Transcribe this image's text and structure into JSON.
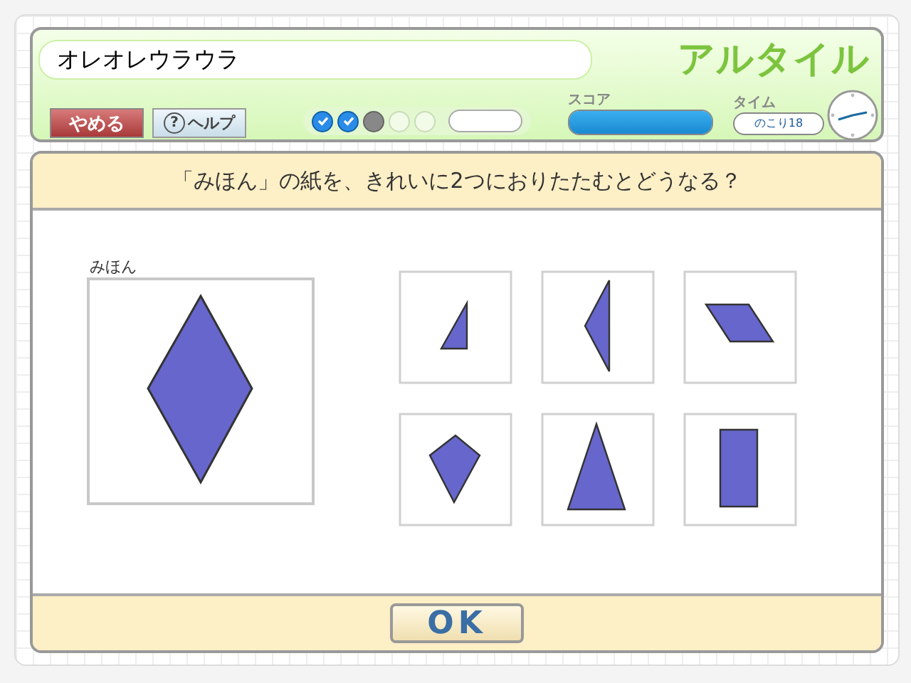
{
  "header": {
    "player_name": "オレオレウラウラ",
    "logo": "アルタイル",
    "quit_button": "やめる",
    "help_button": "ヘルプ",
    "help_icon": "?",
    "progress": [
      {
        "kind": "done"
      },
      {
        "kind": "done"
      },
      {
        "kind": "current"
      },
      {
        "kind": "pending"
      },
      {
        "kind": "pending"
      }
    ],
    "score_label": "スコア",
    "score": {
      "level": 1
    },
    "time_label": "タイム",
    "time_remaining": "のこり18"
  },
  "question": "「みほん」の紙を、きれいに2つにおりたたむとどうなる？",
  "sample": {
    "label": "みほん",
    "kind": "rhombus"
  },
  "options": [
    {
      "kind": "small-triangle"
    },
    {
      "kind": "tall-triangle"
    },
    {
      "kind": "parallelogram"
    },
    {
      "kind": "kite"
    },
    {
      "kind": "isosceles"
    },
    {
      "kind": "rectangle"
    }
  ],
  "ok_button": "OK"
}
